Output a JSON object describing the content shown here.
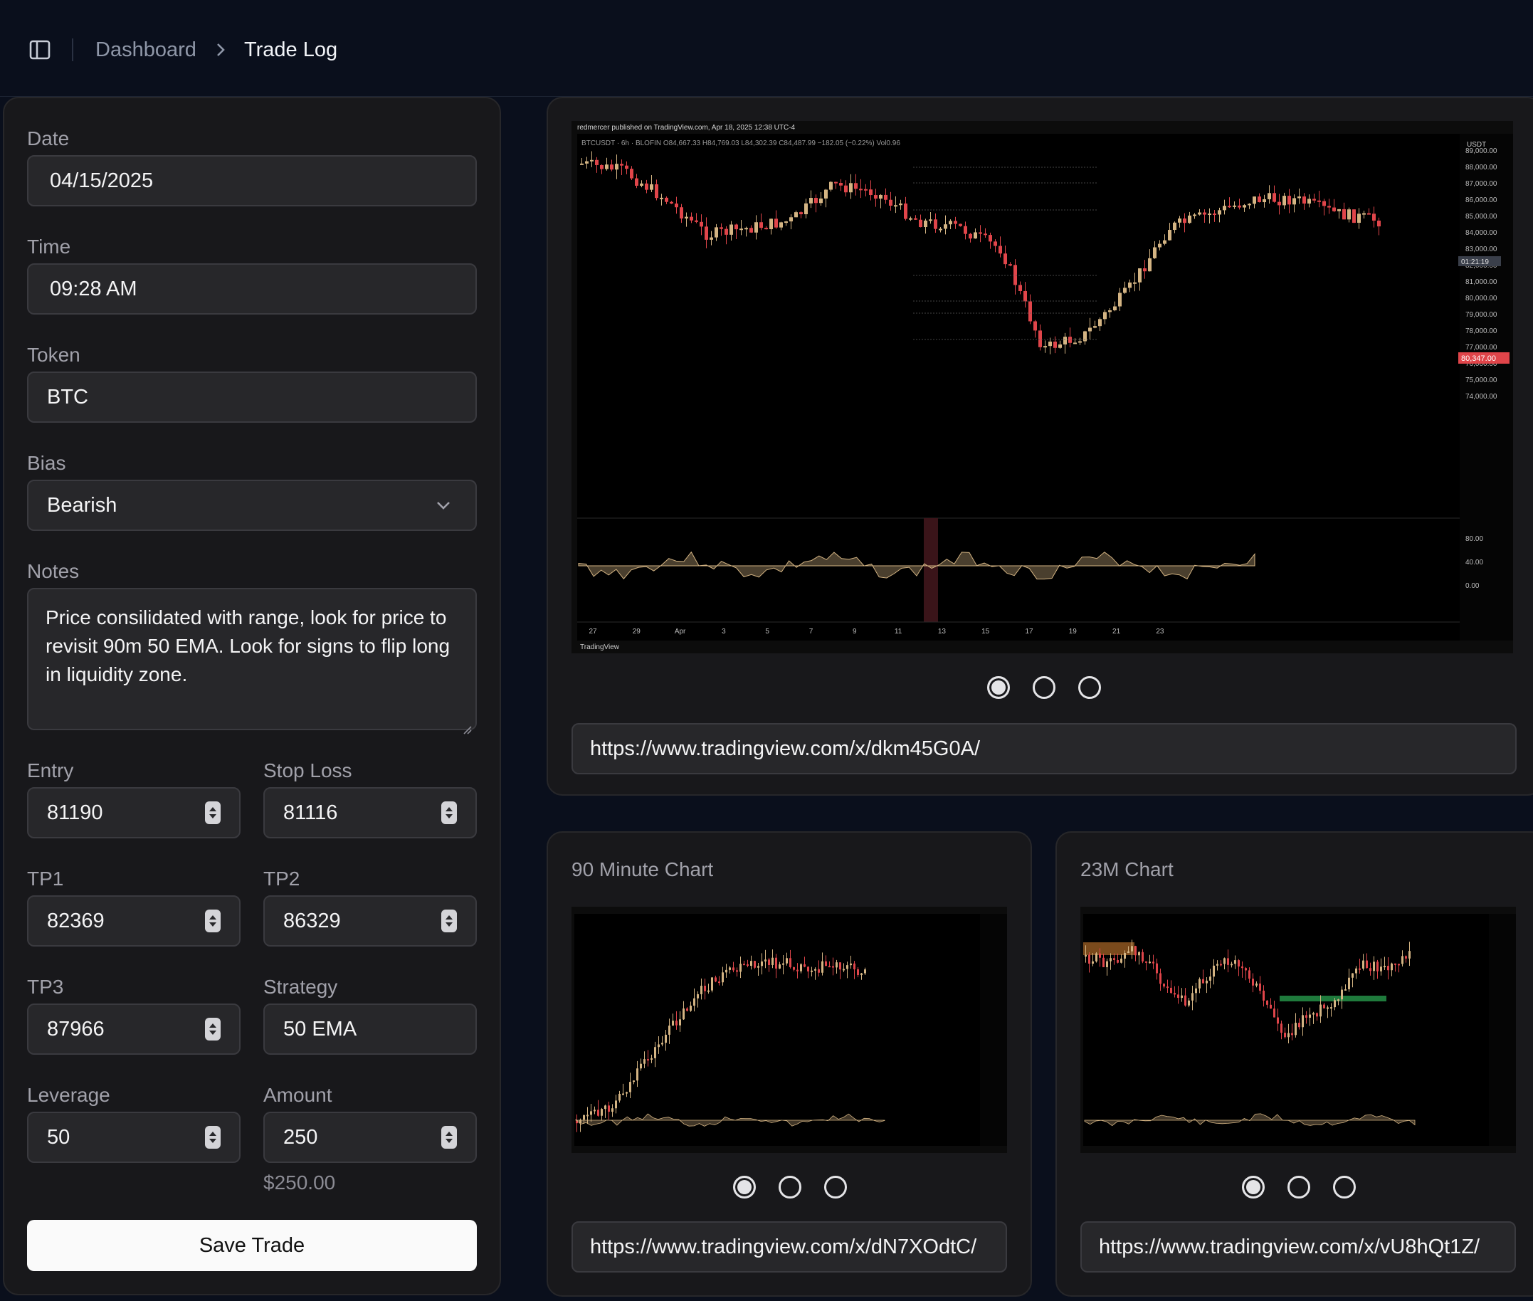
{
  "breadcrumb": {
    "root": "Dashboard",
    "current": "Trade Log"
  },
  "form": {
    "date": {
      "label": "Date",
      "value": "04/15/2025"
    },
    "time": {
      "label": "Time",
      "value": "09:28 AM"
    },
    "token": {
      "label": "Token",
      "value": "BTC"
    },
    "bias": {
      "label": "Bias",
      "value": "Bearish"
    },
    "notes": {
      "label": "Notes",
      "value": "Price consilidated with range, look for price to revisit 90m 50 EMA. Look for signs to flip long in liquidity zone."
    },
    "entry": {
      "label": "Entry",
      "value": "81190"
    },
    "stop_loss": {
      "label": "Stop Loss",
      "value": "81116"
    },
    "tp1": {
      "label": "TP1",
      "value": "82369"
    },
    "tp2": {
      "label": "TP2",
      "value": "86329"
    },
    "tp3": {
      "label": "TP3",
      "value": "87966"
    },
    "strategy": {
      "label": "Strategy",
      "value": "50 EMA"
    },
    "leverage": {
      "label": "Leverage",
      "value": "50"
    },
    "amount": {
      "label": "Amount",
      "value": "250",
      "formatted": "$250.00"
    },
    "save_label": "Save Trade"
  },
  "main_chart": {
    "header_text": "redmercer published on TradingView.com, Apr 18, 2025 12:38 UTC-4",
    "symbol_line": "BTCUSDT · 6h · BLOFIN  O84,667.33 H84,769.03 L84,302.39 C84,487.99 −182.05 (−0.22%)  Vol0.96",
    "currency": "USDT",
    "price_ticks": [
      "89,000.00",
      "88,000.00",
      "87,000.00",
      "86,000.00",
      "85,000.00",
      "84,000.00",
      "83,000.00",
      "82,000.00",
      "81,000.00",
      "80,000.00",
      "79,000.00",
      "78,000.00",
      "77,000.00",
      "76,000.00",
      "75,000.00",
      "74,000.00"
    ],
    "current_price": "80,347.00",
    "countdown": "01:21:19",
    "x_ticks": [
      "27",
      "29",
      "Apr",
      "3",
      "5",
      "7",
      "9",
      "11",
      "13",
      "15",
      "17",
      "19",
      "21",
      "23"
    ],
    "osc_ticks": [
      "80.00",
      "40.00",
      "0.00"
    ],
    "brand": "TradingView",
    "url": "https://www.tradingview.com/x/dkm45G0A/",
    "colors": {
      "up": "#d4b483",
      "down": "#e0454a",
      "ema": "#4a5a80"
    }
  },
  "chart_90": {
    "title": "90 Minute Chart",
    "url": "https://www.tradingview.com/x/dN7XOdtC/"
  },
  "chart_23": {
    "title": "23M Chart",
    "url": "https://www.tradingview.com/x/vU8hQt1Z/"
  }
}
